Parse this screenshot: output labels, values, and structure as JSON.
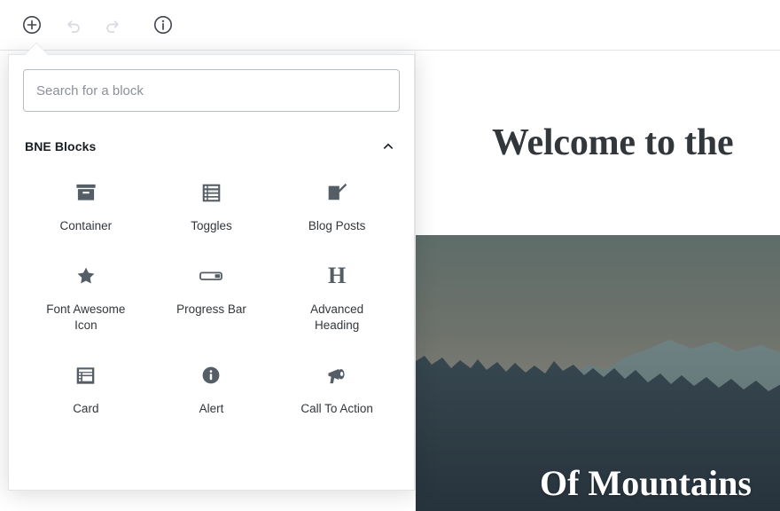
{
  "toolbar": {
    "items": [
      {
        "name": "add-block-button",
        "icon": "plus-circle-icon",
        "label": "Add block",
        "state": "enabled"
      },
      {
        "name": "undo-button",
        "icon": "undo-icon",
        "label": "Undo",
        "state": "disabled"
      },
      {
        "name": "redo-button",
        "icon": "redo-icon",
        "label": "Redo",
        "state": "disabled"
      },
      {
        "name": "info-button",
        "icon": "info-circle-icon",
        "label": "Content structure",
        "state": "enabled"
      }
    ]
  },
  "inserter": {
    "search": {
      "placeholder": "Search for a block",
      "value": ""
    },
    "category": {
      "title": "BNE Blocks",
      "collapse_icon": "chevron-up-icon",
      "expanded": true,
      "blocks": [
        {
          "label": "Container",
          "icon": "archive-box-icon"
        },
        {
          "label": "Toggles",
          "icon": "list-rows-icon"
        },
        {
          "label": "Blog Posts",
          "icon": "pencil-square-icon"
        },
        {
          "label": "Font Awesome Icon",
          "icon": "star-icon"
        },
        {
          "label": "Progress Bar",
          "icon": "progress-bar-icon"
        },
        {
          "label": "Advanced Heading",
          "icon": "heading-h-icon"
        },
        {
          "label": "Card",
          "icon": "card-layout-icon"
        },
        {
          "label": "Alert",
          "icon": "info-filled-icon"
        },
        {
          "label": "Call To Action",
          "icon": "megaphone-icon"
        }
      ]
    }
  },
  "canvas": {
    "welcome_title": "Welcome to the",
    "hero_title": "Of Mountains"
  },
  "colors": {
    "icon": "#555d66",
    "text": "#32373c",
    "placeholder": "#8b9096",
    "border": "#e2e4e7",
    "disabled_icon": "#d7dade"
  }
}
